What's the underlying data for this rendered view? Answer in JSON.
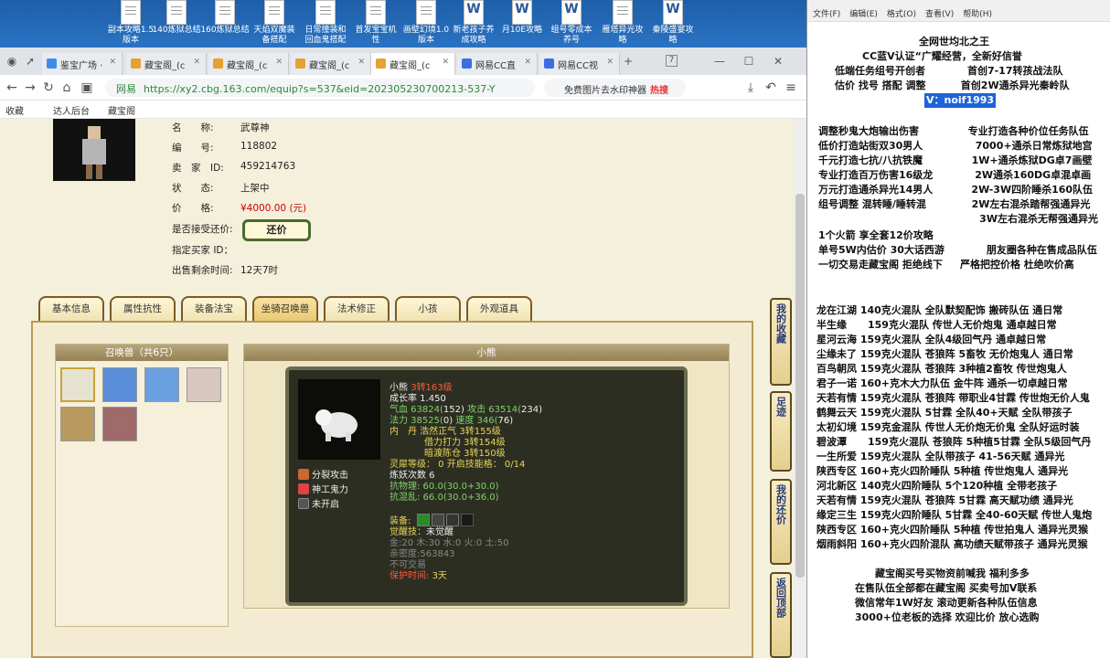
{
  "desktop": {
    "icons": [
      {
        "label": "副本攻略1.5\n版本",
        "type": "doc"
      },
      {
        "label": "140炼狱总结",
        "type": "doc"
      },
      {
        "label": "160炼狱总结",
        "type": "doc"
      },
      {
        "label": "天焰双魔装\n备搭配",
        "type": "doc"
      },
      {
        "label": "日常撞装和\n回血鬼搭配",
        "type": "doc"
      },
      {
        "label": "首发宝宝机\n性",
        "type": "doc"
      },
      {
        "label": "画壁幻境1.0\n版本",
        "type": "doc"
      },
      {
        "label": "新老孩子养\n成攻略",
        "type": "word"
      },
      {
        "label": "月10E攻略",
        "type": "word"
      },
      {
        "label": "组号零成本\n养号",
        "type": "word"
      },
      {
        "label": "雁塔异光攻\n略",
        "type": "doc"
      },
      {
        "label": "秦陵盛宴攻\n略",
        "type": "word"
      }
    ]
  },
  "browser": {
    "tabs": [
      {
        "label": "鉴宝广场 ·",
        "color": "#3a8ee6"
      },
      {
        "label": "藏宝阁_(c",
        "color": "#e8a030"
      },
      {
        "label": "藏宝阁_(c",
        "color": "#e8a030"
      },
      {
        "label": "藏宝阁_(c",
        "color": "#e8a030"
      },
      {
        "label": "藏宝阁_(c",
        "color": "#e8a030",
        "active": true
      },
      {
        "label": "网易CC直",
        "color": "#3a6fe0"
      },
      {
        "label": "网易CC视",
        "color": "#3a6fe0"
      }
    ],
    "new_tab": "+",
    "tab_count": "7",
    "site_name": "网易",
    "url": "https://xy2.cbg.163.com/equip?s=537&eid=202305230700213-537-Y",
    "search_placeholder": "免费图片去水印神器",
    "search_hot": "热搜",
    "bookmarks": [
      "收藏",
      "达人后台",
      "藏宝阁"
    ]
  },
  "listing": {
    "fields": [
      {
        "label": "名　　称:",
        "value": "武尊神"
      },
      {
        "label": "编　　号:",
        "value": "118802"
      },
      {
        "label": "卖　家　ID:",
        "value": "459214763"
      },
      {
        "label": "状　　态:",
        "value": "上架中"
      },
      {
        "label": "价　　格:",
        "value": "¥4000.00 (元)",
        "red": true
      },
      {
        "label": "是否接受还价:",
        "value": ""
      },
      {
        "label": "指定买家 ID：",
        "value": ""
      },
      {
        "label": "出售剩余时间:",
        "value": "12天7时"
      }
    ],
    "haggle_button": "还价"
  },
  "page_tabs": [
    "基本信息",
    "属性抗性",
    "装备法宝",
    "坐骑召唤兽",
    "法术修正",
    "小孩",
    "外观道具"
  ],
  "active_tab": 3,
  "pets": {
    "header": "召唤兽（共6只）",
    "icons": [
      "polar-bear",
      "ice-spirit",
      "ice-spirit-2",
      "lady",
      "warrior",
      "demon"
    ]
  },
  "pet_detail": {
    "header": "小熊",
    "name": "小熊",
    "level": "3转163级",
    "growth": "成长率 1.450",
    "hp": "气血 63824(",
    "hp_add": "152)",
    "atk": "攻击 63514(",
    "atk_add": "234)",
    "mp": "法力 38525(",
    "mp_add": "0)",
    "spd": "速度 346(",
    "spd_add": "76)",
    "dan1": "内　丹  浩然正气 3转155级",
    "dan2": "借力打力 3转154级",
    "dan3": "暗渡陈仓 3转150级",
    "spirit": "灵犀等级：  0 开启技能格：  0/14",
    "refine": "炼妖次数 6",
    "anti1": "抗物理: 60.0(30.0+30.0)",
    "anti2": "抗混乱: 66.0(30.0+36.0)",
    "equip_label": "装备:",
    "awaken_label": "觉醒技：",
    "awaken_value": "未觉醒",
    "elements": "金:20 木:30 水:0 火:0 土:50",
    "intimacy": "亲密度:563843",
    "trade": "不可交易",
    "protect_label": "保护时间:",
    "protect_value": "3天",
    "skills": [
      "分裂攻击",
      "神工鬼力",
      "未开启"
    ]
  },
  "side_buttons": [
    "我的收藏",
    "足迹",
    "我的还价",
    "返回顶部"
  ],
  "notepad": {
    "menu": [
      "文件(F)",
      "编辑(E)",
      "格式(O)",
      "查看(V)",
      "帮助(H)"
    ],
    "lines": [
      "全网世均北之王",
      "CC蓝V认证“广耀经营，全新好信誉",
      "低端任务组号开创者            首创7-17转孩战法队",
      "估价 找号 搭配 调整          首创2W通杀异光秦岭队",
      "V：noif1993",
      "调整秒鬼大炮输出伤害              专业打造各种价位任务队伍",
      "低价打造站街双30男人               7000+通杀日常炼狱地宫",
      "千元打造七抗/八抗铁魔              1W+通杀炼狱DG卓7画壁",
      "专业打造百万伤害16级龙            2W通杀160DG卓混卓画",
      "万元打造通杀异光14男人           2W-3W四阶睡杀160队伍",
      "组号调整 混转睡/睡转混             2W左右混杀踏帮强通异光",
      "                                              3W左右混杀无帮强通异光",
      "1个火箭 享全套12价攻略",
      "单号5W内估价 30大话西游            朋友圈各种在售成品队伍",
      "一切交易走藏宝阁 拒绝线下     严格把控价格 杜绝吹价高",
      "龙在江湖 140克火混队 全队默契配饰 搬砖队伍 通日常",
      "半生缘      159克火混队 传世人无价炮鬼 通卓越日常",
      "星河云海 159克火混队 全队4级回气丹 通卓越日常",
      "尘缘未了 159克火混队 苍狼阵 5畜牧 无价炮鬼人 通日常",
      "百鸟朝凤 159克火混队 苍狼阵 3种植2畜牧 传世炮鬼人",
      "君子一诺 160+克木大力队伍 金牛阵 通杀一切卓越日常",
      "天若有情 159克火混队 苍狼阵 带职业4甘霖 传世炮无价人鬼",
      "鹤舞云天 159克火混队 5甘霖 全队40+天赋 全队带孩子",
      "太初幻境 159克金混队 传世人无价炮无价鬼 全队好运时装",
      "碧波潭      159克火混队 苍狼阵 5种植5甘霖 全队5级回气丹",
      "一生所爱 159克火混队 全队带孩子 41-56天赋 通异光",
      "陕西专区 160+克火四阶睡队 5种植 传世炮鬼人 通异光",
      "河北新区 140克火四阶睡队 5个120种植 全带老孩子",
      "天若有情 159克火混队 苍狼阵 5甘霖 高天赋功绩 通异光",
      "缘定三生 159克火四阶睡队 5甘霖 全40-60天赋 传世人鬼炮",
      "陕西专区 160+克火四阶睡队 5种植 传世拍鬼人 通异光灵猴",
      "烟雨斜阳 160+克火四阶混队 高功绩天赋带孩子 通异光灵猴",
      "藏宝阁买号买物资前喊我 福利多多",
      "在售队伍全部都在藏宝阁 买卖号加V联系",
      "微信常年1W好友 滚动更新各种队伍信息",
      "3000+位老板的选择 欢迎比价 放心选购"
    ]
  }
}
